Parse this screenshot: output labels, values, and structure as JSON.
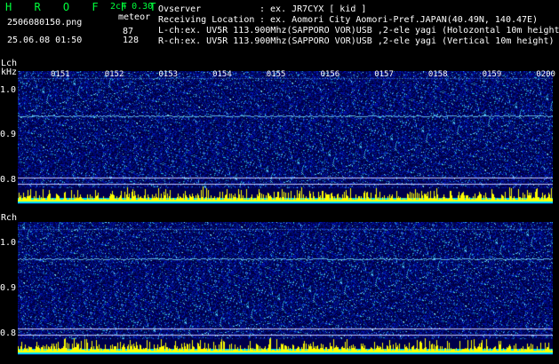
{
  "app": {
    "brand": "H R O F F T",
    "version": "2ch 0.30",
    "mode": "meteor",
    "filename": "2506080150.png",
    "datetime": "25.06.08 01:50",
    "lch_count": "87",
    "rch_count": "128"
  },
  "info": {
    "observer_label": "Ovserver",
    "observer_value": ": ex. JR7CYX [ kid ]",
    "location_label": "Receiving Location",
    "location_value": ": ex. Aomori City Aomori-Pref.JAPAN(40.49N, 140.47E)",
    "lch_line": "L-ch:ex. UV5R 113.900Mhz(SAPPORO VOR)USB ,2-ele yagi (Holozontal 10m height)",
    "rch_line": "R-ch:ex. UV5R 113.900Mhz(SAPPORO VOR)USB ,2-ele yagi (Vertical 10m height)"
  },
  "panels": {
    "lch": {
      "label": "Lch",
      "unit": "kHz",
      "ticks": [
        "1.0",
        "0.9",
        "0.8"
      ]
    },
    "rch": {
      "label": "Rch",
      "ticks": [
        "1.0",
        "0.9",
        "0.8"
      ]
    }
  },
  "times": [
    "0151",
    "0152",
    "0153",
    "0154",
    "0155",
    "0156",
    "0157",
    "0158",
    "0159",
    "0200"
  ]
}
